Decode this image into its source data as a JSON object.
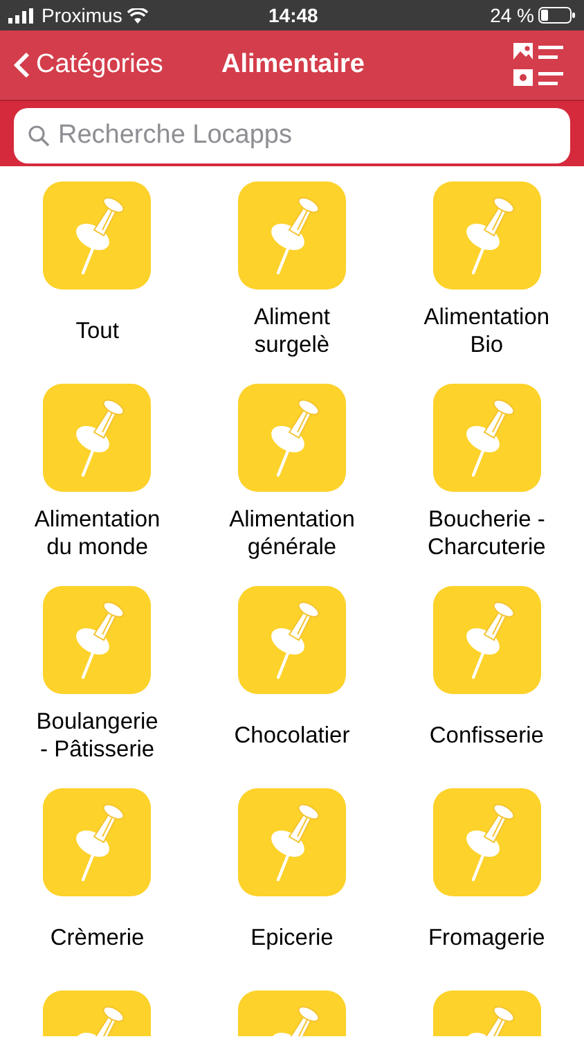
{
  "status_bar": {
    "carrier": "Proximus",
    "time": "14:48",
    "battery": "24 %"
  },
  "nav": {
    "back": "Catégories",
    "title": "Alimentaire"
  },
  "search": {
    "placeholder": "Recherche Locapps"
  },
  "categories": [
    {
      "kind": "tile",
      "label": "Tout"
    },
    {
      "kind": "tile",
      "label": "Aliment\nsurgelè"
    },
    {
      "kind": "tile",
      "label": "Alimentation\nBio"
    },
    {
      "kind": "tile",
      "label": "Alimentation\ndu monde"
    },
    {
      "kind": "tile",
      "label": "Alimentation\ngénérale"
    },
    {
      "kind": "tile",
      "label": "Boucherie -\nCharcuterie"
    },
    {
      "kind": "tile",
      "label": "Boulangerie\n- Pâtisserie"
    },
    {
      "kind": "tile",
      "label": "Chocolatier"
    },
    {
      "kind": "tile",
      "label": "Confisserie"
    },
    {
      "kind": "tile",
      "label": "Crèmerie"
    },
    {
      "kind": "tile",
      "label": "Epicerie"
    },
    {
      "kind": "tile",
      "label": "Fromagerie"
    },
    {
      "kind": "cut_off"
    },
    {
      "kind": "cut_off"
    },
    {
      "kind": "cut_off"
    }
  ]
}
